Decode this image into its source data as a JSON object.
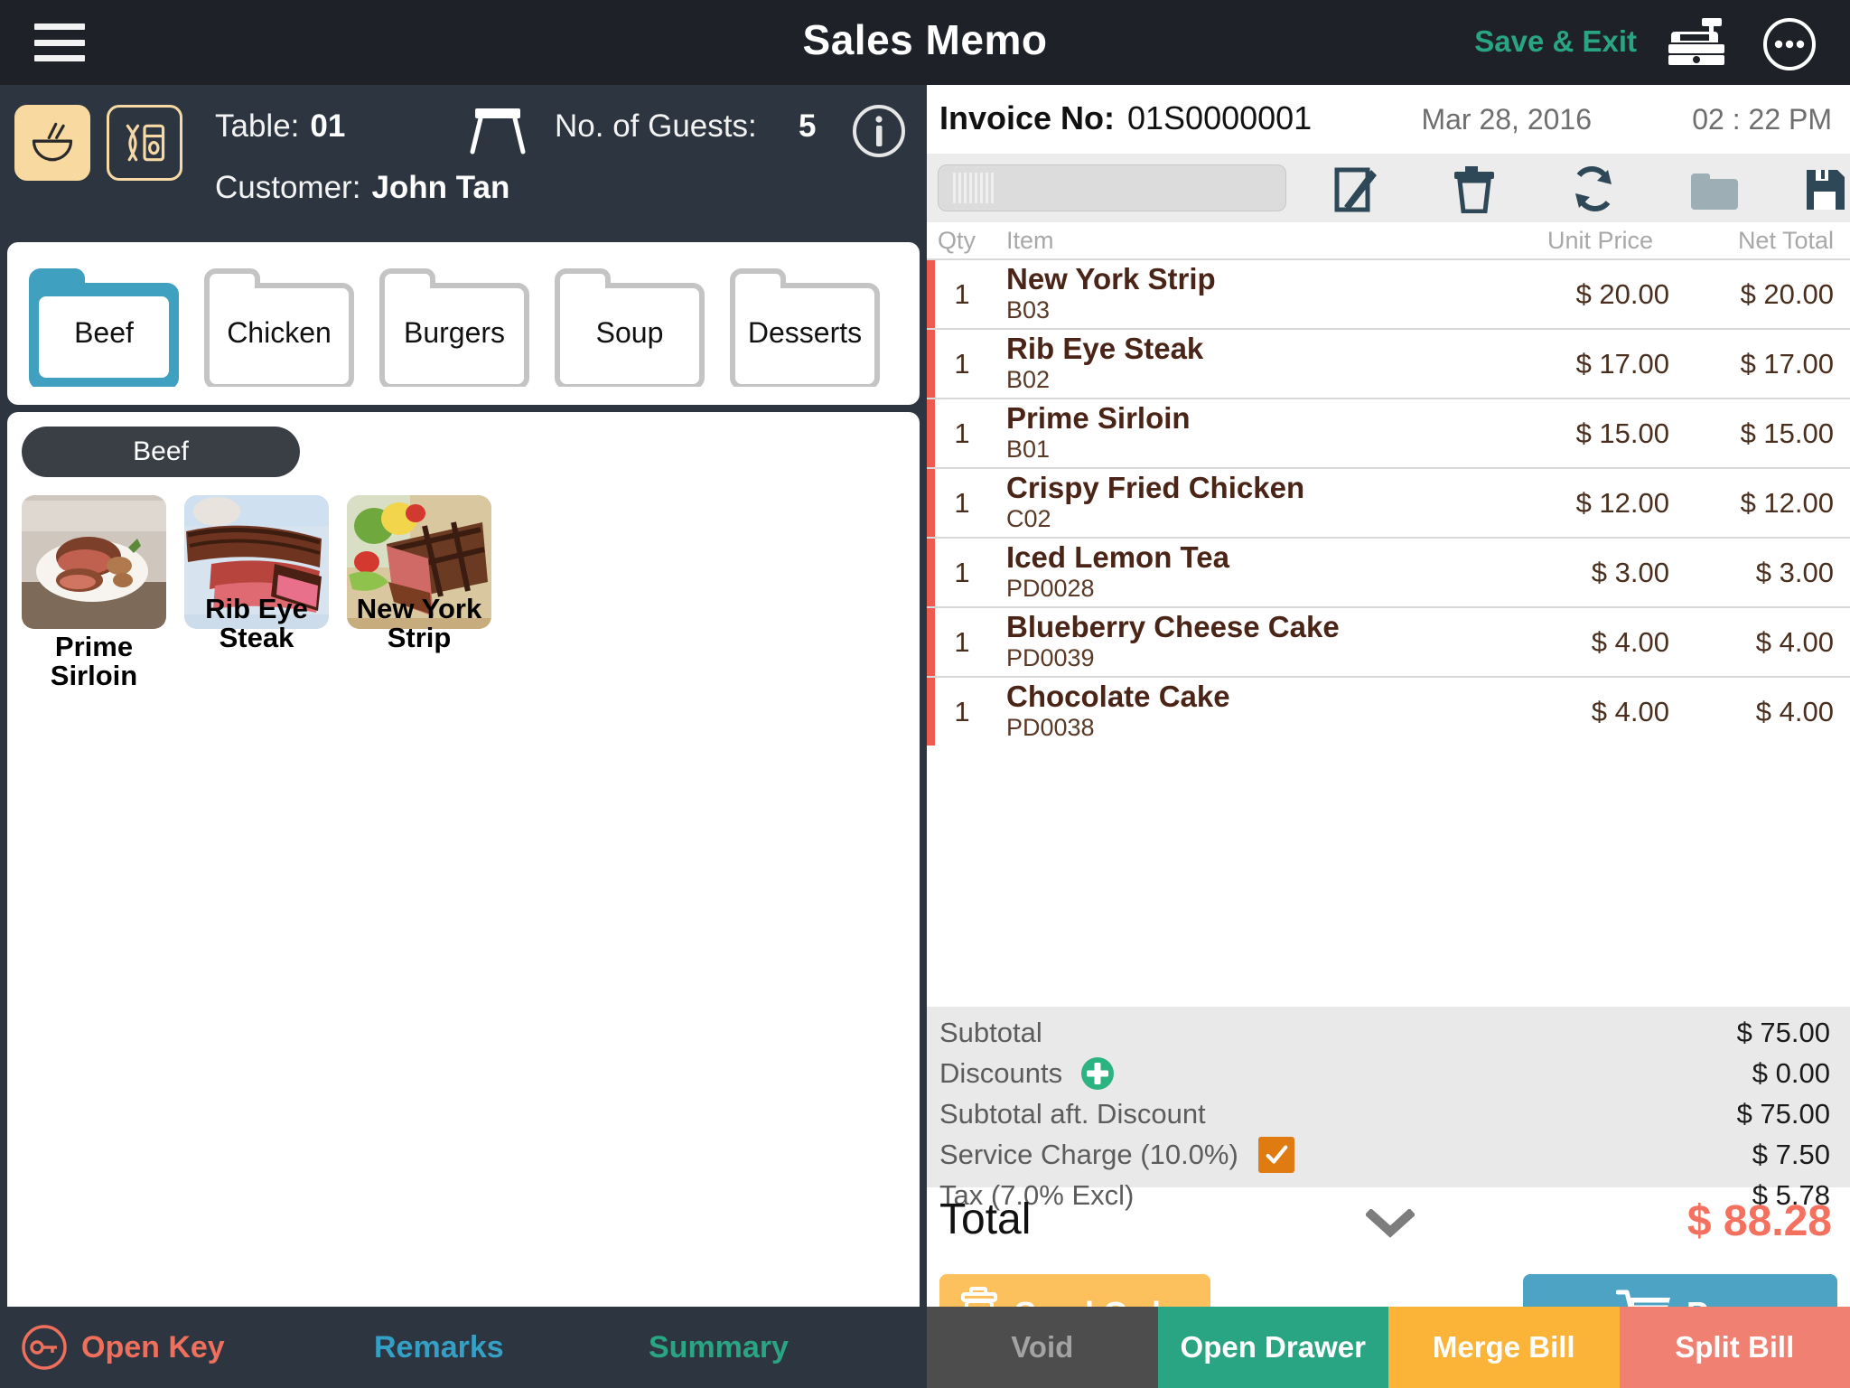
{
  "topbar": {
    "menu_icon": "hamburger-icon",
    "title": "Sales Memo",
    "save_exit_label": "Save & Exit",
    "register_icon": "cash-register-icon",
    "more_icon": "more-options-icon",
    "accent_green": "#2aa583",
    "background": "#1e2228"
  },
  "table_info": {
    "dine_in_icon": "dine-in-bowl-icon",
    "takeaway_icon": "takeaway-cup-icon",
    "table_label": "Table:",
    "table_value": "01",
    "table_icon": "table-icon",
    "guests_label": "No. of Guests:",
    "guests_value": "5",
    "info_icon": "info-icon",
    "customer_label": "Customer:",
    "customer_value": "John Tan",
    "panel_background": "#2d3640"
  },
  "categories": {
    "selected": "Beef",
    "selected_color": "#3fa0c0",
    "items": [
      {
        "label": "Beef"
      },
      {
        "label": "Chicken"
      },
      {
        "label": "Burgers"
      },
      {
        "label": "Soup"
      },
      {
        "label": "Desserts"
      }
    ]
  },
  "products": {
    "group_label": "Beef",
    "items": [
      {
        "name": "Prime Sirloin",
        "lines": 1
      },
      {
        "name": "Rib Eye Steak",
        "lines": 2
      },
      {
        "name": "New York Strip",
        "lines": 2
      }
    ]
  },
  "left_footer": {
    "open_key": "Open Key",
    "open_key_icon": "key-icon",
    "remarks": "Remarks",
    "summary": "Summary",
    "open_key_color": "#ef6f5d",
    "remarks_color": "#35a0c5",
    "summary_color": "#2aa583"
  },
  "invoice": {
    "label": "Invoice No:",
    "number": "01S0000001",
    "date": "Mar 28, 2016",
    "time": "02 : 22 PM"
  },
  "toolbar": {
    "barcode_placeholder": "",
    "barcode_icon": "barcode-icon",
    "icons": [
      {
        "name": "edit-icon"
      },
      {
        "name": "trash-icon"
      },
      {
        "name": "refresh-icon"
      },
      {
        "name": "folder-icon"
      },
      {
        "name": "save-icon"
      }
    ]
  },
  "order": {
    "columns": [
      "Qty",
      "Item",
      "Unit Price",
      "Net Total"
    ],
    "accent_color": "#ef5a4f",
    "rows": [
      {
        "qty": "1",
        "name": "New York Strip",
        "code": "B03",
        "unit_price": "$ 20.00",
        "net_total": "$ 20.00"
      },
      {
        "qty": "1",
        "name": "Rib Eye Steak",
        "code": "B02",
        "unit_price": "$ 17.00",
        "net_total": "$ 17.00"
      },
      {
        "qty": "1",
        "name": "Prime Sirloin",
        "code": "B01",
        "unit_price": "$ 15.00",
        "net_total": "$ 15.00"
      },
      {
        "qty": "1",
        "name": "Crispy Fried Chicken",
        "code": "C02",
        "unit_price": "$ 12.00",
        "net_total": "$ 12.00"
      },
      {
        "qty": "1",
        "name": "Iced Lemon Tea",
        "code": "PD0028",
        "unit_price": "$ 3.00",
        "net_total": "$ 3.00"
      },
      {
        "qty": "1",
        "name": "Blueberry Cheese Cake",
        "code": "PD0039",
        "unit_price": "$ 4.00",
        "net_total": "$ 4.00"
      },
      {
        "qty": "1",
        "name": "Chocolate Cake",
        "code": "PD0038",
        "unit_price": "$ 4.00",
        "net_total": "$ 4.00"
      }
    ]
  },
  "summary": {
    "subtotal_label": "Subtotal",
    "subtotal_value": "$ 75.00",
    "discounts_label": "Discounts",
    "discounts_value": "$ 0.00",
    "discounts_add_icon": "add-discount-icon",
    "subtotal_after_label": "Subtotal aft. Discount",
    "subtotal_after_value": "$ 75.00",
    "service_charge_label": "Service Charge (10.0%)",
    "service_charge_value": "$ 7.50",
    "service_charge_checked": true,
    "service_charge_check_color": "#e07b12",
    "tax_label": "Tax (7.0% Excl)",
    "tax_value": "$ 5.78",
    "total_label": "Total",
    "total_value": "$ 88.28",
    "total_color": "#f4705f",
    "expand_icon": "chevron-down-icon"
  },
  "actions": {
    "send_order_label": "Send Order",
    "send_order_icon": "send-order-icon",
    "send_order_color": "#fcc05c",
    "pay_label": "Pay",
    "pay_icon": "shopping-cart-icon",
    "pay_color": "#4da3c4"
  },
  "right_footer": {
    "buttons": [
      {
        "label": "Void",
        "color": "#4d4d4d"
      },
      {
        "label": "Open Drawer",
        "color": "#2aa583"
      },
      {
        "label": "Merge Bill",
        "color": "#fbb338"
      },
      {
        "label": "Split Bill",
        "color": "#ef8072"
      }
    ]
  }
}
